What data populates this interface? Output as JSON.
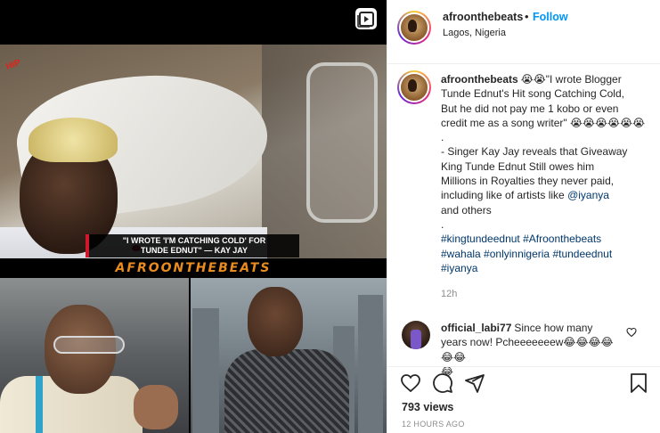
{
  "post": {
    "video_overlay": {
      "caption_line1": "\"I WROTE 'I'M CATCHING COLD' FOR",
      "caption_line2": "TUNDE EDNUT\" — KAY JAY",
      "brand": "AFROONTHEBEATS",
      "logo_text": "HIP"
    },
    "header": {
      "username": "afroonthebeats",
      "separator": "•",
      "follow_label": "Follow",
      "location": "Lagos, Nigeria"
    },
    "caption": {
      "username": "afroonthebeats",
      "line1": "😭😭\"I wrote Blogger",
      "line2": "Tunde Ednut's Hit song Catching Cold,",
      "line3": "But he did not pay me 1 kobo or even",
      "line4": "credit me as a song writer\" 😭😭😭😭😭😭",
      "dot1": ".",
      "body1": "- Singer Kay Jay reveals that Giveaway",
      "body2": "King Tunde Ednut Still owes him",
      "body3": "Millions in Royalties they never paid,",
      "body4_prefix": "including like of artists like",
      "mention": "@iyanya",
      "body5": "and others",
      "dot2": ".",
      "hashtags": [
        "#kingtundeednut",
        "#Afroonthebeats",
        "#wahala",
        "#onlyinnigeria",
        "#tundeednut",
        "#iyanya"
      ],
      "time": "12h"
    },
    "comment": {
      "username": "official_labi77",
      "text_line1": "Since how many",
      "text_line2": "years now! Pcheeeeeeew😂😂😂😂😂😂",
      "text_line3": "😂"
    },
    "views": "793 views",
    "age": "12 HOURS AGO",
    "icons": {
      "video": "video-icon",
      "like": "heart-icon",
      "comment": "comment-icon",
      "share": "share-icon",
      "save": "bookmark-icon",
      "comment_like": "heart-icon"
    }
  }
}
